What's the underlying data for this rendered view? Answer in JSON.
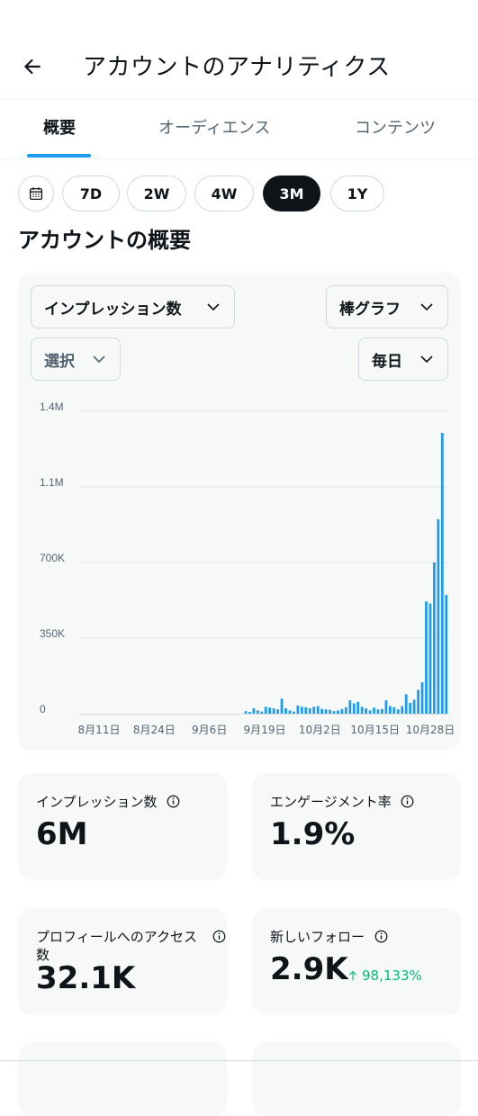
{
  "header": {
    "title": "アカウントのアナリティクス"
  },
  "tabs": [
    {
      "label": "概要",
      "active": true
    },
    {
      "label": "オーディエンス",
      "active": false
    },
    {
      "label": "コンテンツ",
      "active": false
    }
  ],
  "ranges": [
    {
      "label": "7D",
      "selected": false
    },
    {
      "label": "2W",
      "selected": false
    },
    {
      "label": "4W",
      "selected": false
    },
    {
      "label": "3M",
      "selected": true
    },
    {
      "label": "1Y",
      "selected": false
    }
  ],
  "section_title": "アカウントの概要",
  "controls": {
    "metric": "インプレッション数",
    "chart_type": "棒グラフ",
    "compare": "選択",
    "interval": "毎日"
  },
  "chart_data": {
    "type": "bar",
    "ylim": [
      0,
      1400000
    ],
    "yticks": [
      0,
      350000,
      700000,
      1050000,
      1400000
    ],
    "ytick_labels": [
      "0",
      "350K",
      "700K",
      "1.1M",
      "1.4M"
    ],
    "xtick_labels": [
      "8月11日",
      "8月24日",
      "9月6日",
      "9月19日",
      "10月2日",
      "10月15日",
      "10月28日"
    ],
    "grid": true,
    "color": "#1d9bf0",
    "values": [
      0,
      0,
      0,
      0,
      0,
      0,
      0,
      0,
      0,
      0,
      0,
      0,
      0,
      0,
      0,
      0,
      0,
      0,
      0,
      0,
      0,
      0,
      0,
      0,
      0,
      0,
      0,
      0,
      0,
      0,
      0,
      0,
      0,
      0,
      0,
      0,
      0,
      0,
      0,
      0,
      0,
      12000,
      8000,
      25000,
      15000,
      10000,
      32000,
      28000,
      25000,
      20000,
      70000,
      25000,
      15000,
      10000,
      38000,
      32000,
      30000,
      25000,
      32000,
      35000,
      22000,
      20000,
      18000,
      12000,
      15000,
      22000,
      30000,
      62000,
      48000,
      55000,
      32000,
      25000,
      15000,
      28000,
      20000,
      22000,
      62000,
      35000,
      30000,
      20000,
      35000,
      90000,
      50000,
      65000,
      110000,
      145000,
      520000,
      510000,
      700000,
      900000,
      1300000,
      550000
    ]
  },
  "stats": [
    {
      "label": "インプレッション数",
      "value": "6M",
      "delta": ""
    },
    {
      "label": "エンゲージメント率",
      "value": "1.9%",
      "delta": ""
    },
    {
      "label": "プロフィールへのアクセス数",
      "label_line1": "プロフィールへのアクセス",
      "label_line2": "数",
      "value": "32.1K",
      "delta": ""
    },
    {
      "label": "新しいフォロー",
      "value": "2.9K",
      "delta": "98,133%"
    }
  ]
}
